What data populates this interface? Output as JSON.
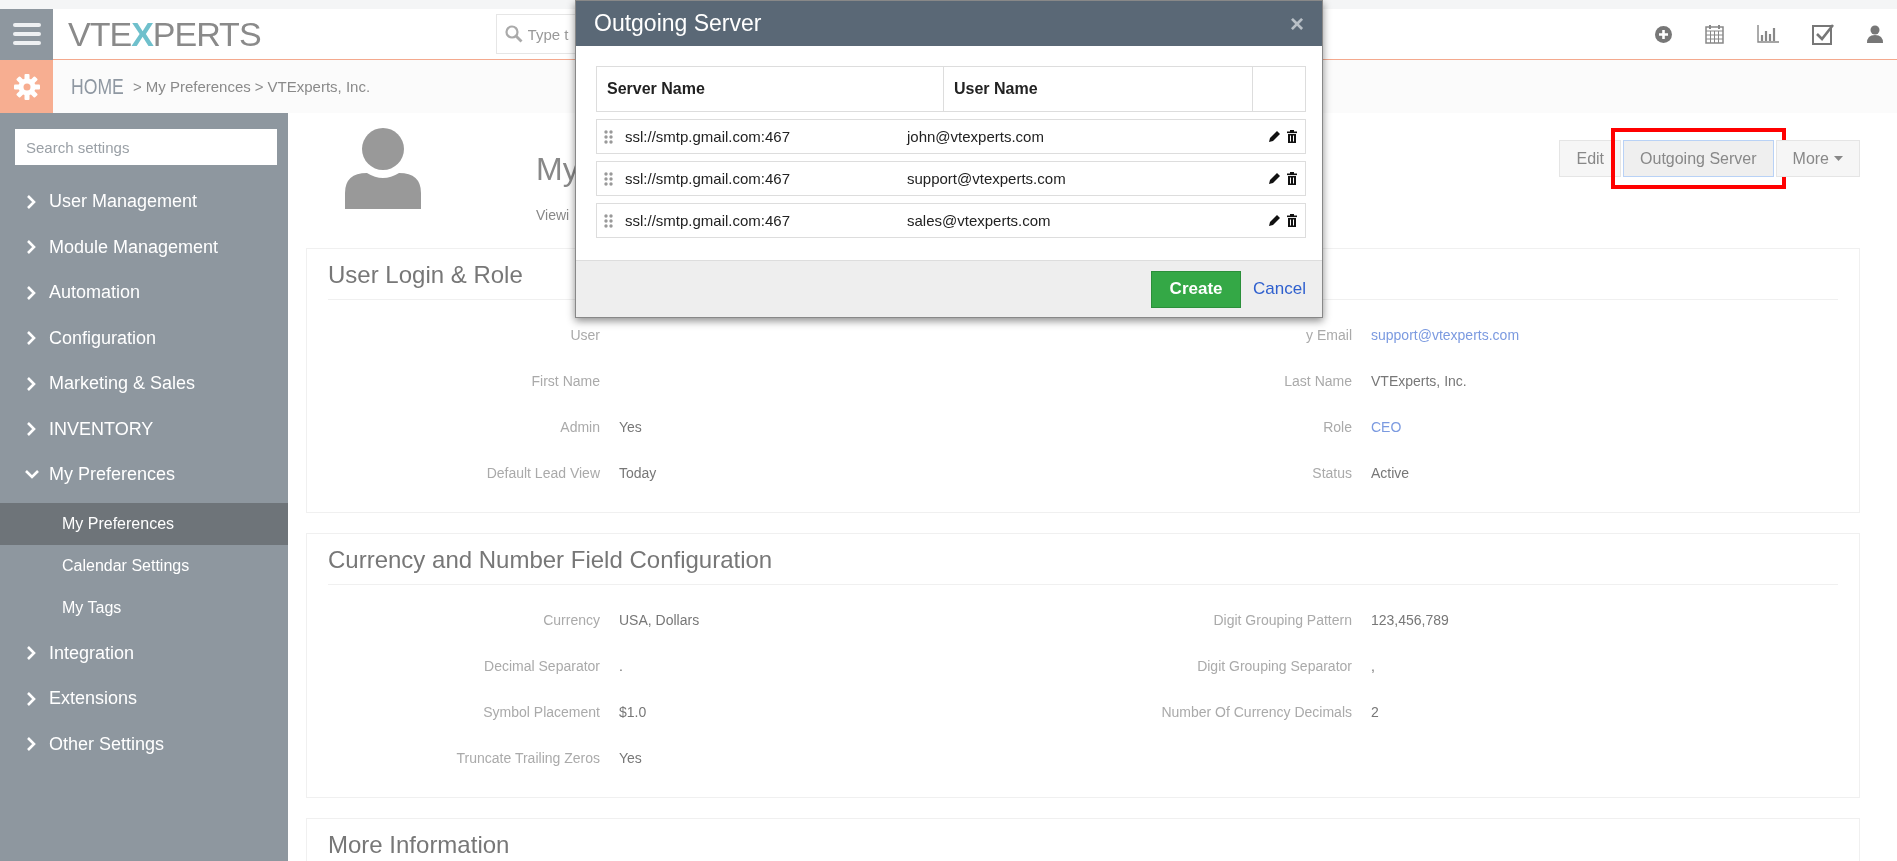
{
  "header": {
    "logo": [
      {
        "text": "VTE",
        "kind": "plain"
      },
      {
        "text": "X",
        "kind": "accent"
      },
      {
        "text": "PERTS",
        "kind": "plain"
      }
    ],
    "search": {
      "placeholder": "Type t"
    }
  },
  "breadcrumb": {
    "home": "HOME",
    "separator": ">",
    "items": [
      "My Preferences",
      "VTExperts, Inc."
    ]
  },
  "sidebar": {
    "search": {
      "placeholder": "Search settings"
    },
    "items": [
      {
        "label": "User Management",
        "expanded": false
      },
      {
        "label": "Module Management",
        "expanded": false
      },
      {
        "label": "Automation",
        "expanded": false
      },
      {
        "label": "Configuration",
        "expanded": false
      },
      {
        "label": "Marketing & Sales",
        "expanded": false
      },
      {
        "label": "INVENTORY",
        "expanded": false
      },
      {
        "label": "My Preferences",
        "expanded": true,
        "children": [
          {
            "label": "My Preferences",
            "selected": true
          },
          {
            "label": "Calendar Settings",
            "selected": false
          },
          {
            "label": "My Tags",
            "selected": false
          }
        ]
      },
      {
        "label": "Integration",
        "expanded": false
      },
      {
        "label": "Extensions",
        "expanded": false
      },
      {
        "label": "Other Settings",
        "expanded": false
      }
    ]
  },
  "profile": {
    "title": "My",
    "subtitle": "Viewi"
  },
  "actions": [
    {
      "label": "Edit",
      "highlighted": false,
      "dropdown": false
    },
    {
      "label": "Outgoing Server",
      "highlighted": true,
      "dropdown": false
    },
    {
      "label": "More",
      "highlighted": false,
      "dropdown": true
    }
  ],
  "sections": [
    {
      "title": "User Login & Role",
      "rows": [
        [
          {
            "label": "User"
          },
          {
            "label": "y Email",
            "value": "support@vtexperts.com",
            "link": true
          }
        ],
        [
          {
            "label": "First Name"
          },
          {
            "label": "Last Name",
            "value": "VTExperts, Inc.",
            "link": false
          }
        ],
        [
          {
            "label": "Admin",
            "value": "Yes",
            "link": false
          },
          {
            "label": "Role",
            "value": "CEO",
            "link": true
          }
        ],
        [
          {
            "label": "Default Lead View",
            "value": "Today",
            "link": false
          },
          {
            "label": "Status",
            "value": "Active",
            "link": false
          }
        ]
      ]
    },
    {
      "title": "Currency and Number Field Configuration",
      "rows": [
        [
          {
            "label": "Currency",
            "value": "USA, Dollars",
            "link": false
          },
          {
            "label": "Digit Grouping Pattern",
            "value": "123,456,789",
            "link": false
          }
        ],
        [
          {
            "label": "Decimal Separator",
            "value": ".",
            "link": false
          },
          {
            "label": "Digit Grouping Separator",
            "value": ",",
            "link": false
          }
        ],
        [
          {
            "label": "Symbol Placement",
            "value": "$1.0",
            "link": false
          },
          {
            "label": "Number Of Currency Decimals",
            "value": "2",
            "link": false
          }
        ],
        [
          {
            "label": "Truncate Trailing Zeros",
            "value": "Yes",
            "link": false
          }
        ]
      ]
    },
    {
      "title": "More Information"
    }
  ],
  "modal": {
    "title": "Outgoing Server",
    "close": "×",
    "table": {
      "columns": [
        "Server Name",
        "User Name"
      ],
      "rows": [
        {
          "server": "ssl://smtp.gmail.com:467",
          "user": "john@vtexperts.com"
        },
        {
          "server": "ssl://smtp.gmail.com:467",
          "user": "support@vtexperts.com"
        },
        {
          "server": "ssl://smtp.gmail.com:467",
          "user": "sales@vtexperts.com"
        }
      ]
    },
    "buttons": {
      "create": "Create",
      "cancel": "Cancel"
    }
  }
}
